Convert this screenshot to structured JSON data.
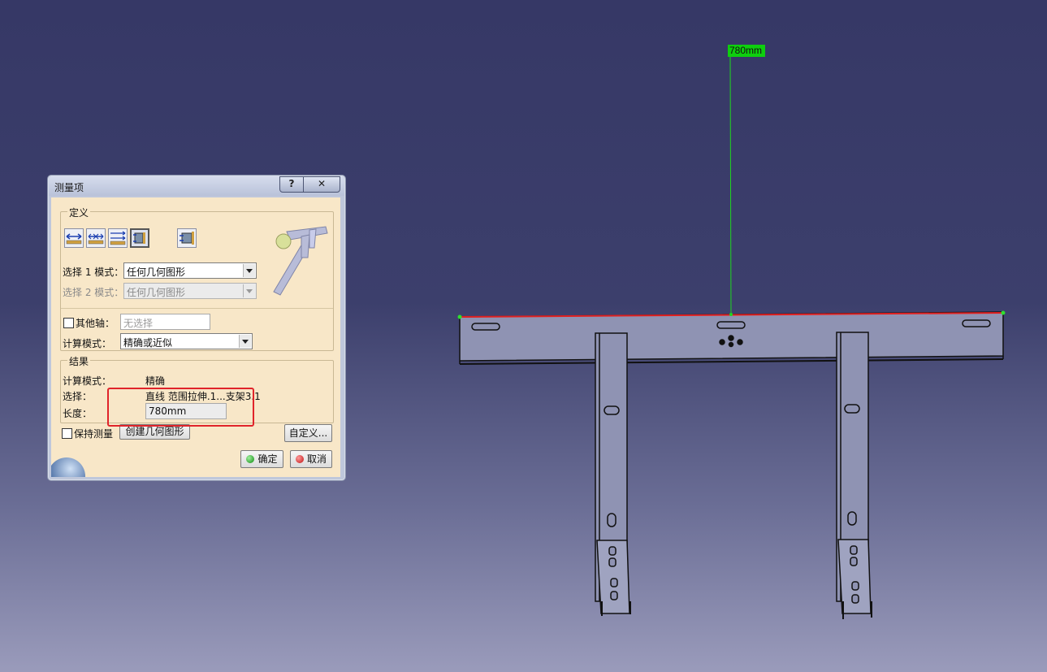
{
  "dialog": {
    "title": "测量项",
    "help_label": "?",
    "close_label": "✕",
    "definition": {
      "group_title": "定义",
      "selection1_label": "选择 1 模式：",
      "selection1_value": "任何几何图形",
      "selection2_label": "选择 2 模式：",
      "selection2_value": "任何几何图形",
      "other_axis_label": "其他轴：",
      "other_axis_placeholder": "无选择",
      "calc_mode_label": "计算模式：",
      "calc_mode_value": "精确或近似"
    },
    "results": {
      "group_title": "结果",
      "calc_mode_label": "计算模式：",
      "calc_mode_value": "精确",
      "selection_label": "选择：",
      "selection_value": "直线 范围拉伸.1...支架3.1",
      "length_label": "长度：",
      "length_value": "780mm"
    },
    "keep_measure_label": "保持测量",
    "create_geometry_label": "创建几何图形",
    "customize_label": "自定义...",
    "ok_label": "确定",
    "cancel_label": "取消"
  },
  "viewport": {
    "dimension_label": "780mm",
    "measure_color": "#e02020",
    "dimension_color": "#0ecf0e",
    "background_top": "#363866",
    "background_bottom": "#9a9bbb"
  }
}
